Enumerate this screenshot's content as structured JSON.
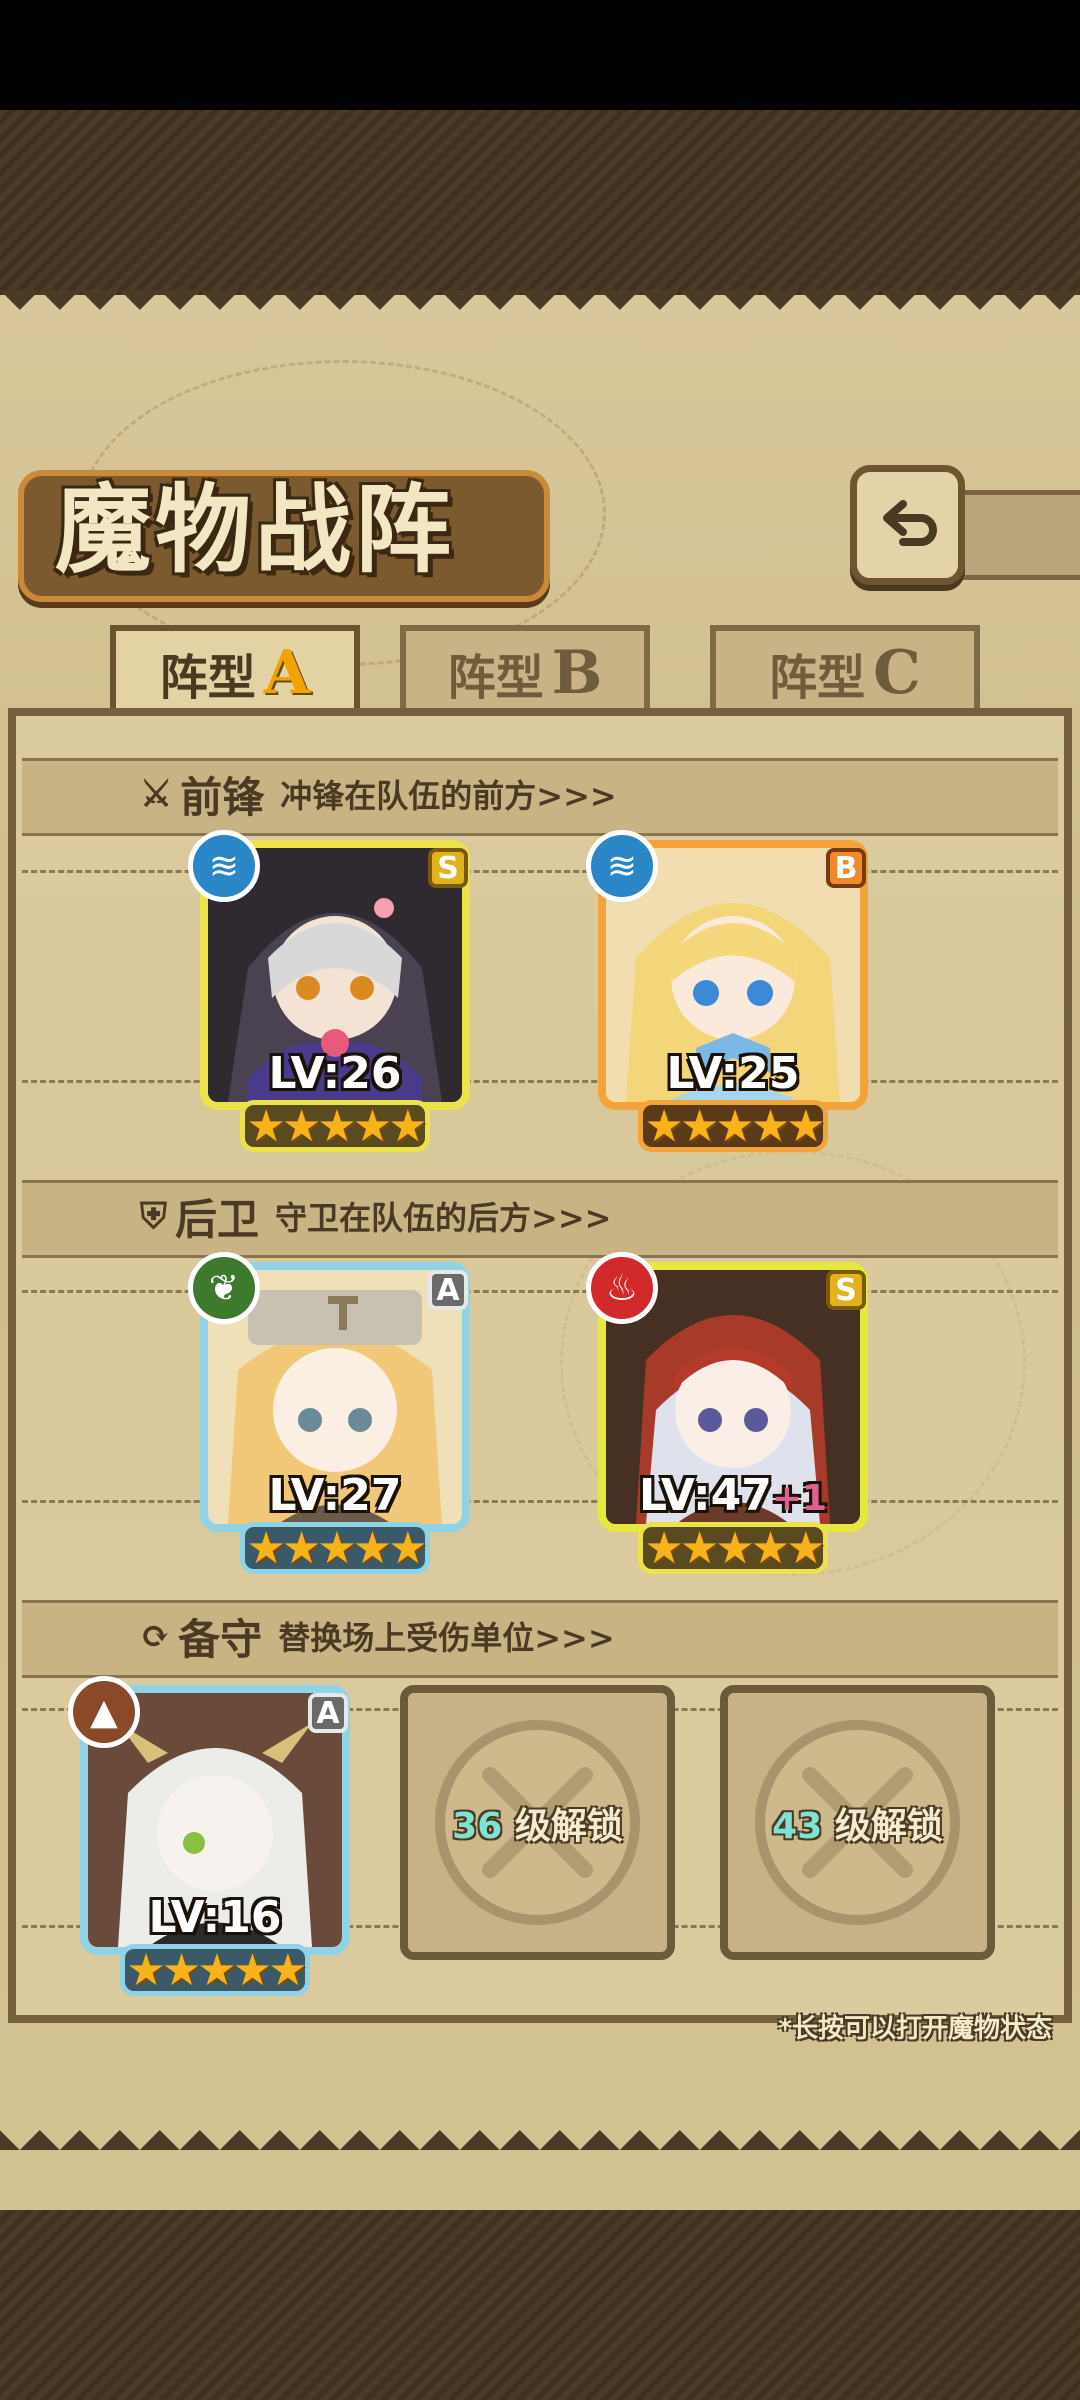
{
  "title": "魔物战阵",
  "tabs": [
    {
      "label": "阵型",
      "letter": "A",
      "active": true
    },
    {
      "label": "阵型",
      "letter": "B",
      "active": false
    },
    {
      "label": "阵型",
      "letter": "C",
      "active": false
    }
  ],
  "sections": {
    "front": {
      "title": "前锋",
      "desc": "冲锋在队伍的前方>>>"
    },
    "rear": {
      "title": "后卫",
      "desc": "守卫在队伍的后方>>>"
    },
    "reserve": {
      "title": "备守",
      "desc": "替换场上受伤单位>>>"
    }
  },
  "monsters": [
    {
      "slot": "front-1",
      "level": "LV:26",
      "rank": "S",
      "element": "water",
      "stars": 5
    },
    {
      "slot": "front-2",
      "level": "LV:25",
      "rank": "B",
      "element": "water",
      "stars": 5
    },
    {
      "slot": "rear-1",
      "level": "LV:27",
      "rank": "A",
      "element": "nature",
      "stars": 5
    },
    {
      "slot": "rear-2",
      "level": "LV:47",
      "bonus": "+1",
      "rank": "S",
      "element": "fire",
      "stars": 5
    },
    {
      "slot": "reserve-1",
      "level": "LV:16",
      "rank": "A",
      "element": "earth",
      "stars": 5
    }
  ],
  "locked_slots": [
    {
      "level": "36",
      "text": "级解锁"
    },
    {
      "level": "43",
      "text": "级解锁"
    }
  ],
  "stars_text": "★★★★★",
  "hint": "*长按可以打开魔物状态",
  "colors": {
    "water": "#2a86c6",
    "nature": "#3d7a2e",
    "fire": "#d22a2a",
    "earth": "#8a4a2a",
    "star": "#f8b21a"
  }
}
